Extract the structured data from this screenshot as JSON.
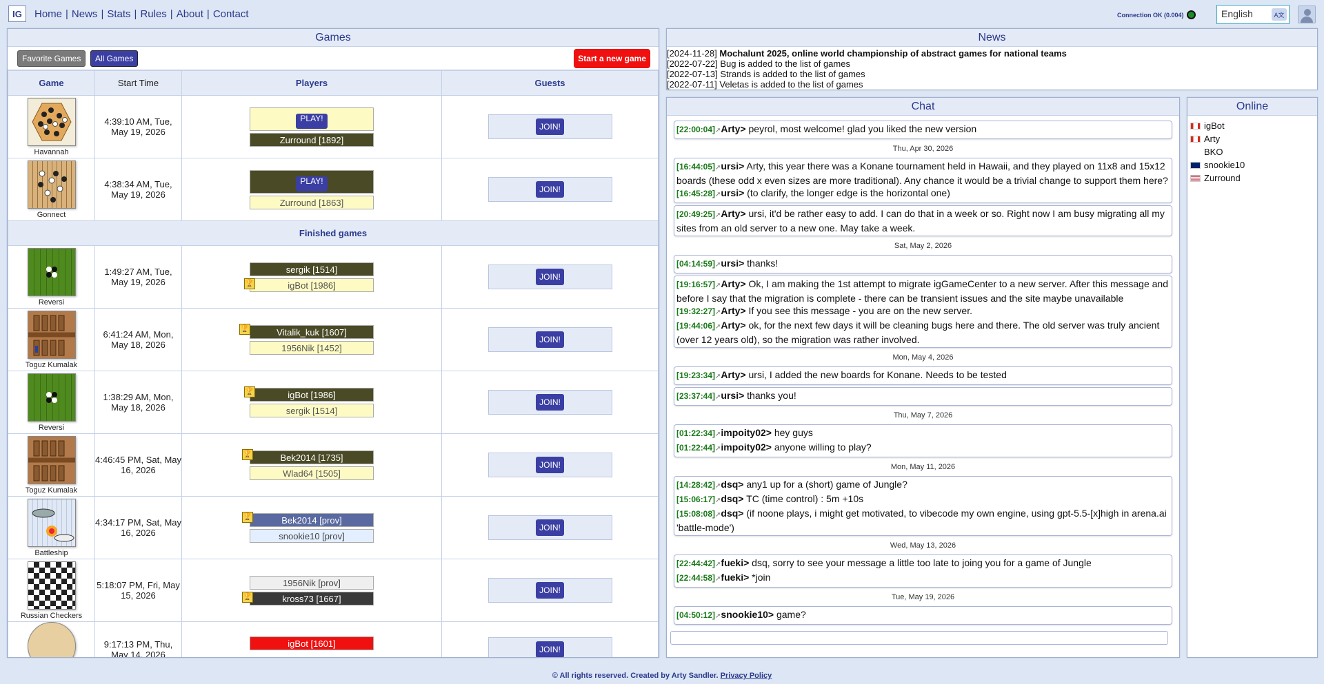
{
  "nav": {
    "logo": "IG",
    "items": [
      "Home",
      "News",
      "Stats",
      "Rules",
      "About",
      "Contact"
    ],
    "sep": "|"
  },
  "connection": "Connection OK (0.004)",
  "language": "English",
  "games": {
    "title": "Games",
    "fav_label": "Favorite Games",
    "all_label": "All Games",
    "start_label": "Start a new game",
    "headers": [
      "Game",
      "Start Time",
      "Players",
      "Guests"
    ],
    "finished_label": "Finished games",
    "join": "JOIN!",
    "play": "PLAY!",
    "active": [
      {
        "game": "Havannah",
        "time": "4:39:10 AM, Tue, May 19, 2026",
        "p1": "PLAY!",
        "p2": "Zurround [1892]"
      },
      {
        "game": "Gonnect",
        "time": "4:38:34 AM, Tue, May 19, 2026",
        "p1": "PLAY!",
        "p2": "Zurround [1863]"
      }
    ],
    "finished": [
      {
        "game": "Reversi",
        "time": "1:49:27 AM, Tue, May 19, 2026",
        "p1": "sergik [1514]",
        "p2": "igBot [1986]"
      },
      {
        "game": "Toguz Kumalak",
        "time": "6:41:24 AM, Mon, May 18, 2026",
        "p1": "Vitalik_kuk [1607]",
        "p2": "1956Nik [1452]"
      },
      {
        "game": "Reversi",
        "time": "1:38:29 AM, Mon, May 18, 2026",
        "p1": "igBot [1986]",
        "p2": "sergik [1514]"
      },
      {
        "game": "Toguz Kumalak",
        "time": "4:46:45 PM, Sat, May 16, 2026",
        "p1": "Bek2014 [1735]",
        "p2": "Wlad64 [1505]"
      },
      {
        "game": "Battleship",
        "time": "4:34:17 PM, Sat, May 16, 2026",
        "p1": "Bek2014 [prov]",
        "p2": "snookie10 [prov]"
      },
      {
        "game": "Russian Checkers",
        "time": "5:18:07 PM, Fri, May 15, 2026",
        "p1": "1956Nik [prov]",
        "p2": "kross73 [1667]"
      },
      {
        "game": "",
        "time": "9:17:13 PM, Thu, May 14, 2026",
        "p1": "igBot [1601]",
        "p2": ""
      }
    ]
  },
  "news": {
    "title": "News",
    "items": [
      {
        "date": "[2024-11-28]",
        "text": "Mochalunt 2025, online world championship of abstract games for national teams"
      },
      {
        "date": "[2022-07-22]",
        "text": "Bug is added to the list of games"
      },
      {
        "date": "[2022-07-13]",
        "text": "Strands is added to the list of games"
      },
      {
        "date": "[2022-07-11]",
        "text": "Veletas is added to the list of games"
      }
    ]
  },
  "chat": {
    "title": "Chat",
    "d1": "Thu, Apr 30, 2026",
    "d2": "Sat, May 2, 2026",
    "d3": "Mon, May 4, 2026",
    "d4": "Thu, May 7, 2026",
    "d5": "Mon, May 11, 2026",
    "d6": "Wed, May 13, 2026",
    "d7": "Tue, May 19, 2026",
    "m": [
      {
        "ts": "[22:00:04]",
        "nick": "Arty>",
        "text": "peyrol, most welcome! glad you liked the new version"
      },
      {
        "ts": "[16:44:05]",
        "nick": "ursi>",
        "text": "Arty, this year there was a Konane tournament held in Hawaii, and they played on 11x8 and 15x12 boards (these odd x even sizes are more traditional). Any chance it would be a trivial change to support them here?"
      },
      {
        "ts": "[16:45:28]",
        "nick": "ursi>",
        "text": "(to clarify, the longer edge is the horizontal one)"
      },
      {
        "ts": "[20:49:25]",
        "nick": "Arty>",
        "text": "ursi, it'd be rather easy to add. I can do that in a week or so. Right now I am busy migrating all my sites from an old server to a new one. May take a week."
      },
      {
        "ts": "[04:14:59]",
        "nick": "ursi>",
        "text": "thanks!"
      },
      {
        "ts": "[19:16:57]",
        "nick": "Arty>",
        "text": "Ok, I am making the 1st attempt to migrate igGameCenter to a new server. After this message and before I say that the migration is complete - there can be transient issues and the site maybe unavailable"
      },
      {
        "ts": "[19:32:27]",
        "nick": "Arty>",
        "text": "If you see this message - you are on the new server."
      },
      {
        "ts": "[19:44:06]",
        "nick": "Arty>",
        "text": "ok, for the next few days it will be cleaning bugs here and there. The old server was truly ancient (over 12 years old), so the migration was rather involved."
      },
      {
        "ts": "[19:23:34]",
        "nick": "Arty>",
        "text": "ursi, I added the new boards for Konane. Needs to be tested"
      },
      {
        "ts": "[23:37:44]",
        "nick": "ursi>",
        "text": "thanks you!"
      },
      {
        "ts": "[01:22:34]",
        "nick": "impoity02>",
        "text": "hey guys"
      },
      {
        "ts": "[01:22:44]",
        "nick": "impoity02>",
        "text": "anyone willing to play?"
      },
      {
        "ts": "[14:28:42]",
        "nick": "dsq>",
        "text": "any1 up for a (short) game of Jungle?"
      },
      {
        "ts": "[15:06:17]",
        "nick": "dsq>",
        "text": "TC (time control) : 5m +10s"
      },
      {
        "ts": "[15:08:08]",
        "nick": "dsq>",
        "text": "(if noone plays, i might get motivated, to vibecode my own engine, using gpt-5.5-[x]high in arena.ai 'battle-mode')"
      },
      {
        "ts": "[22:44:42]",
        "nick": "fueki>",
        "text": "dsq, sorry to see your message a little too late to joing you for a game of Jungle"
      },
      {
        "ts": "[22:44:58]",
        "nick": "fueki>",
        "text": "*join"
      },
      {
        "ts": "[04:50:12]",
        "nick": "snookie10>",
        "text": "game?"
      }
    ]
  },
  "online": {
    "title": "Online",
    "users": [
      {
        "name": "igBot",
        "flag": "ca"
      },
      {
        "name": "Arty",
        "flag": "ca"
      },
      {
        "name": "BKO",
        "flag": "none"
      },
      {
        "name": "snookie10",
        "flag": "nz"
      },
      {
        "name": "Zurround",
        "flag": "us"
      }
    ]
  },
  "footer": {
    "text": "© All rights reserved. Created by Arty Sandler.",
    "link": "Privacy Policy"
  }
}
